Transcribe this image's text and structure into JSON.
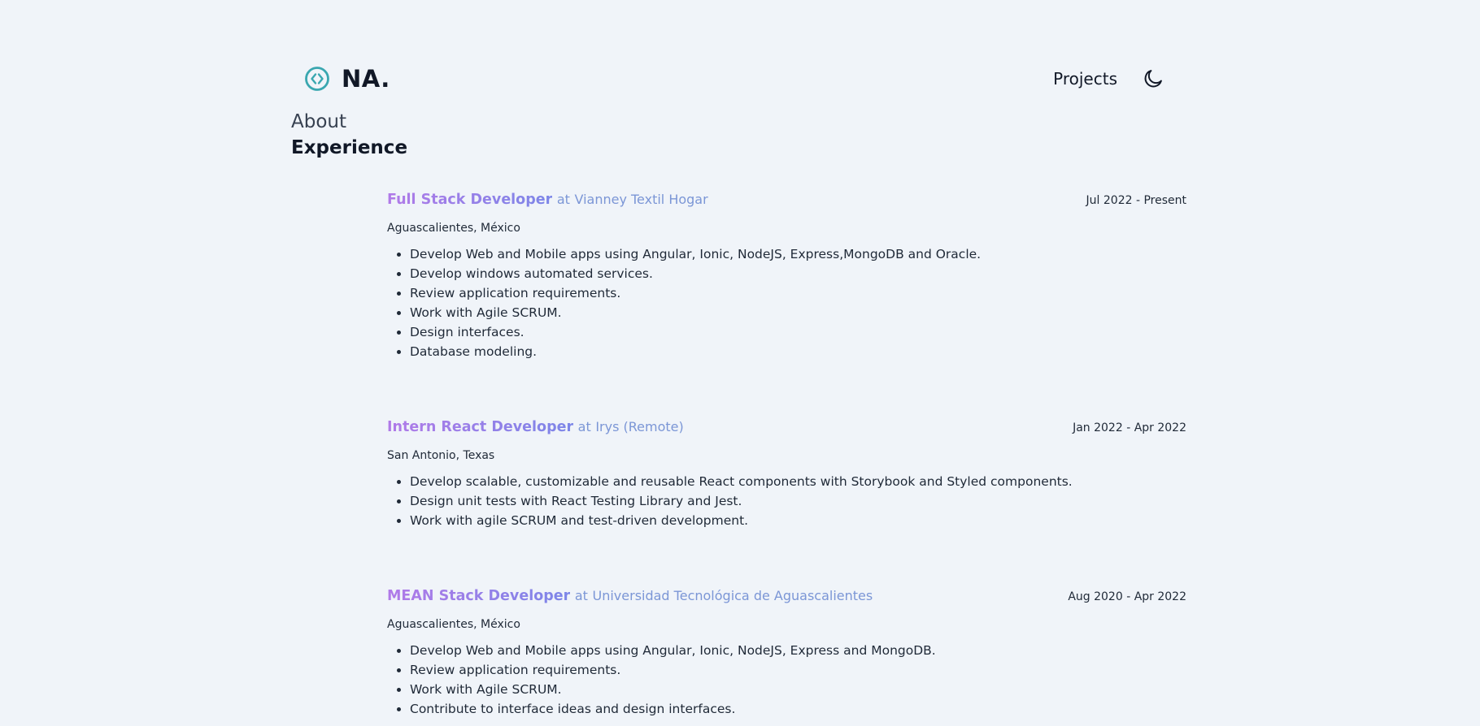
{
  "header": {
    "brand": "NA.",
    "nav": {
      "projects": "Projects"
    }
  },
  "sections": {
    "about": "About",
    "experience": "Experience"
  },
  "jobs": [
    {
      "role": "Full Stack Developer",
      "at": "at",
      "company": "Vianney Textil Hogar",
      "dates": "Jul 2022 - Present",
      "location": "Aguascalientes, México",
      "bullets": [
        "Develop Web and Mobile apps using Angular, Ionic, NodeJS, Express,MongoDB and Oracle.",
        "Develop windows automated services.",
        "Review application requirements.",
        "Work with Agile SCRUM.",
        "Design interfaces.",
        "Database modeling."
      ]
    },
    {
      "role": "Intern React Developer",
      "at": "at",
      "company": "Irys (Remote)",
      "dates": "Jan 2022 - Apr 2022",
      "location": "San Antonio, Texas",
      "bullets": [
        "Develop scalable, customizable and reusable React components with Storybook and Styled components.",
        "Design unit tests with React Testing Library and Jest.",
        "Work with agile SCRUM and test-driven development."
      ]
    },
    {
      "role": "MEAN Stack Developer",
      "at": "at",
      "company": "Universidad Tecnológica de Aguascalientes",
      "dates": "Aug 2020 - Apr 2022",
      "location": "Aguascalientes, México",
      "bullets": [
        "Develop Web and Mobile apps using Angular, Ionic, NodeJS, Express and MongoDB.",
        "Review application requirements.",
        "Work with Agile SCRUM.",
        "Contribute to interface ideas and design interfaces."
      ]
    }
  ],
  "colors": {
    "background": "#f0f4f9",
    "logo": "#3aa7b0",
    "role_gradient_start": "#b17ae8",
    "role_gradient_end": "#7c86e8",
    "company": "#7b96d6"
  },
  "icons": {
    "logo": "code-circle-icon",
    "theme": "moon-icon"
  }
}
